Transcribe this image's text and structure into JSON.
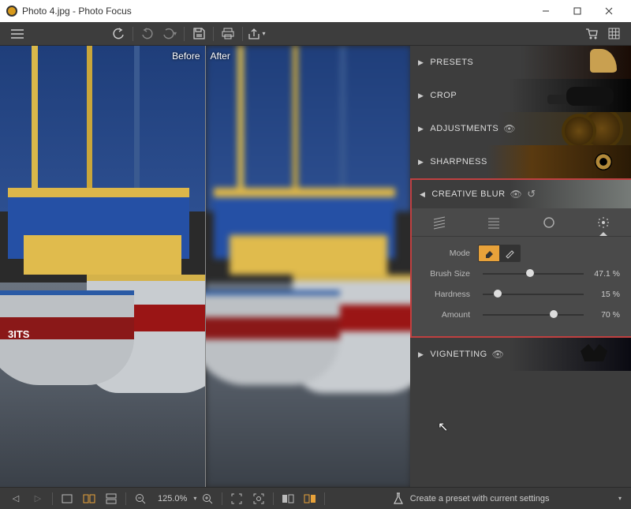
{
  "window": {
    "title": "Photo 4.jpg - Photo Focus"
  },
  "compare": {
    "before": "Before",
    "after": "After"
  },
  "panels": {
    "presets": {
      "label": "PRESETS"
    },
    "crop": {
      "label": "CROP"
    },
    "adjust": {
      "label": "ADJUSTMENTS"
    },
    "sharpness": {
      "label": "SHARPNESS"
    },
    "blur": {
      "label": "CREATIVE BLUR"
    },
    "vignette": {
      "label": "VIGNETTING"
    }
  },
  "blur": {
    "mode_label": "Mode",
    "brush": {
      "label": "Brush Size",
      "value": 47.1,
      "display": "47.1 %"
    },
    "hard": {
      "label": "Hardness",
      "value": 15,
      "display": "15 %"
    },
    "amt": {
      "label": "Amount",
      "value": 70,
      "display": "70 %"
    }
  },
  "zoom": {
    "display": "125.0%"
  },
  "footer": {
    "preset": "Create a preset with current settings"
  },
  "hull_marks": "3ITS"
}
